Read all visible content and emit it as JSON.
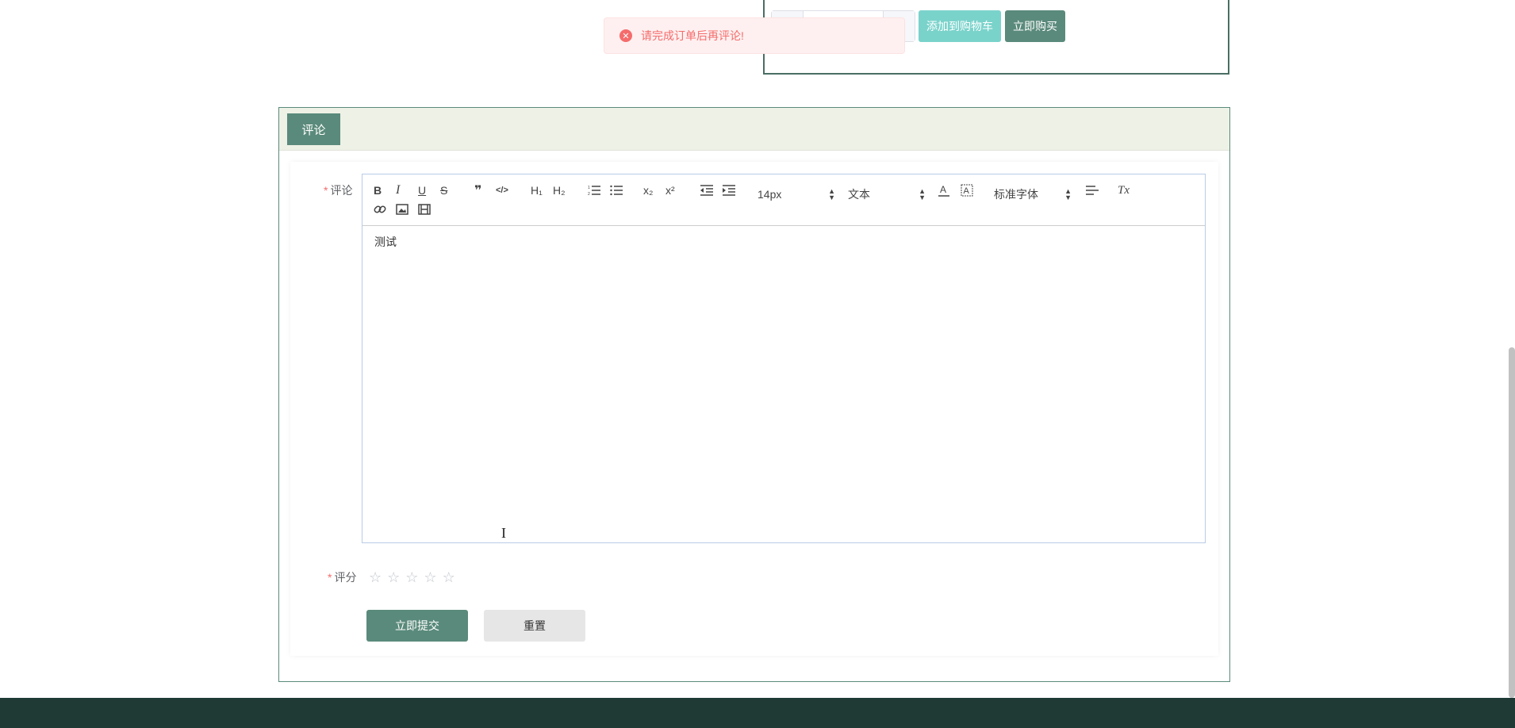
{
  "product": {
    "qty_minus": "−",
    "qty_plus": "+",
    "add_to_cart_label": "添加到购物车",
    "buy_now_label": "立即购买"
  },
  "toast": {
    "icon": "error-circle-icon",
    "message": "请完成订单后再评论!"
  },
  "panel": {
    "tab_label": "评论"
  },
  "form": {
    "comment_label": "评论",
    "rating_label": "评分",
    "required_mark": "*",
    "rating_value": 0,
    "rating_max": 5,
    "submit_label": "立即提交",
    "reset_label": "重置"
  },
  "editor": {
    "font_size": "14px",
    "header_select": "文本",
    "font_family": "标准字体",
    "content": "测试",
    "toolbar": {
      "bold": "B",
      "italic": "I",
      "underline": "U",
      "strike": "S",
      "blockquote": "❞",
      "code": "</>",
      "h1": "H₁",
      "h2": "H₂",
      "subscript": "x₂",
      "superscript": "x²",
      "clean": "Tx"
    }
  },
  "colors": {
    "primary": "#5a8a7b",
    "cart_button": "#7ad3cb",
    "error": "#f56c6c",
    "footer": "#1f3a34"
  }
}
